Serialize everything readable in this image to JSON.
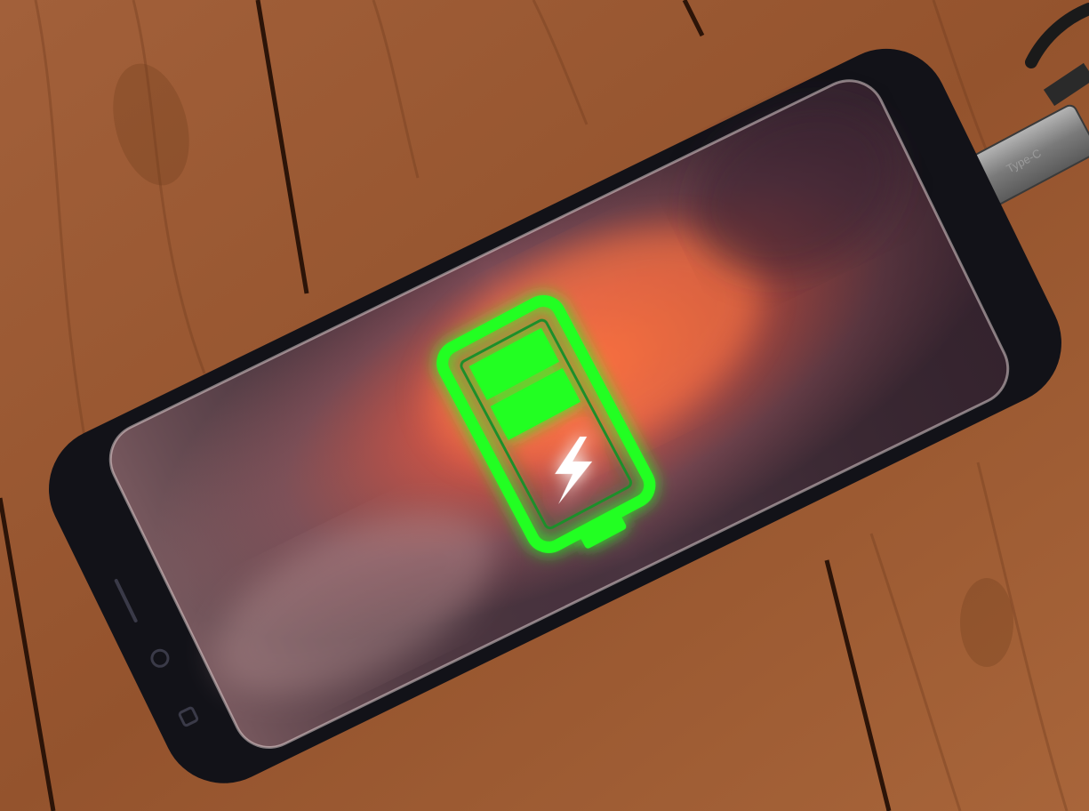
{
  "scene": {
    "background": "wooden-plank-floor",
    "device": "smartphone-charging",
    "colors": {
      "wood_base": "#9b5a32",
      "wood_light": "#b8743f",
      "wood_dark": "#6e3a1c",
      "plank_gap": "#2c1408",
      "phone_frame": "#121218",
      "screen_dark": "#4a3440",
      "screen_glow": "#ff6a3d",
      "battery_green": "#22ff22",
      "bolt": "#ffffff",
      "connector": "#8c8c8c"
    }
  },
  "battery": {
    "icon": "battery-charging-icon",
    "filled_segments": 2,
    "total_segments": 4,
    "charging": true
  },
  "cable": {
    "icon": "usb-connector-icon",
    "label": "Type-C"
  },
  "phone_buttons": {
    "icons": [
      "recent-apps-icon",
      "home-button-icon",
      "back-icon"
    ]
  }
}
